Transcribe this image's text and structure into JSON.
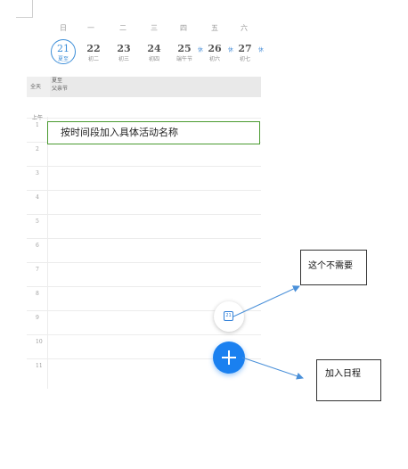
{
  "calendar": {
    "weekdays": [
      "日",
      "一",
      "二",
      "三",
      "四",
      "五",
      "六"
    ],
    "dates": [
      {
        "num": "21",
        "sub": "夏至",
        "today": true,
        "rest": ""
      },
      {
        "num": "22",
        "sub": "初二",
        "today": false,
        "rest": ""
      },
      {
        "num": "23",
        "sub": "初三",
        "today": false,
        "rest": ""
      },
      {
        "num": "24",
        "sub": "初四",
        "today": false,
        "rest": ""
      },
      {
        "num": "25",
        "sub": "端午节",
        "today": false,
        "rest": "休"
      },
      {
        "num": "26",
        "sub": "初六",
        "today": false,
        "rest": "休"
      },
      {
        "num": "27",
        "sub": "初七",
        "today": false,
        "rest": "休"
      }
    ],
    "allday_label": "全天",
    "allday_events": [
      "夏至",
      "父亲节"
    ],
    "am_label": "上午",
    "hours": [
      "1",
      "2",
      "3",
      "4",
      "5",
      "6",
      "7",
      "8",
      "9",
      "10",
      "11"
    ]
  },
  "event_placeholder": "按时间段加入具体活动名称",
  "fab": {
    "small_icon": "calendar-today-icon",
    "small_icon_text": "21",
    "big_icon": "plus-icon",
    "color": "#1a80f0"
  },
  "annotations": {
    "note1": "这个不需要",
    "note2": "加入日程"
  },
  "colors": {
    "accent": "#3c8ed8",
    "event_border": "#4a9a30",
    "arrow": "#4a90d9"
  }
}
